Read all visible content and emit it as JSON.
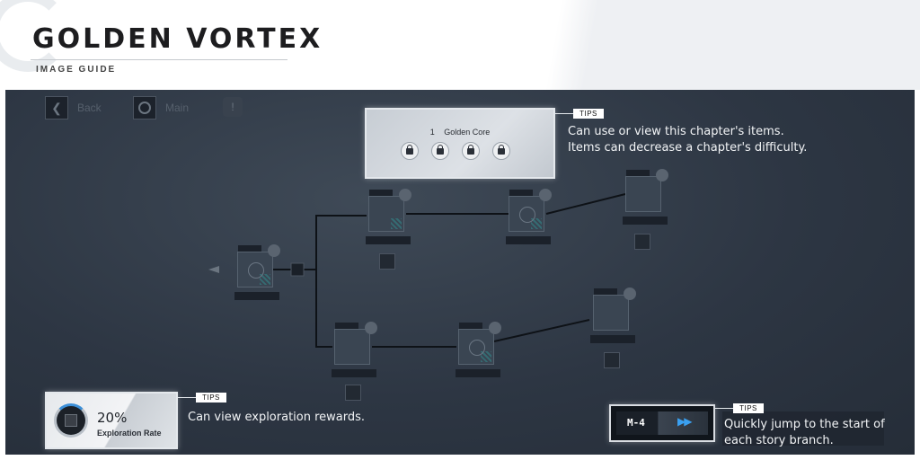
{
  "header": {
    "title": "GOLDEN VORTEX",
    "subtitle": "IMAGE GUIDE"
  },
  "nav": {
    "back_label": "Back",
    "back_icon": "chevron-left-icon",
    "main_label": "Main",
    "main_icon": "circle-icon",
    "info_icon": "info-icon"
  },
  "items_panel": {
    "count": "1",
    "item_name": "Golden Core",
    "slots": [
      "lock-icon",
      "lock-icon",
      "lock-icon",
      "lock-icon"
    ],
    "tips_tag": "TIPS",
    "tips_line1": "Can use or view this chapter's items.",
    "tips_line2": "Items can decrease a chapter's difficulty."
  },
  "exploration": {
    "percent": "20%",
    "label": "Exploration Rate",
    "progress_fraction": 0.2,
    "tips_tag": "TIPS",
    "tips_text": "Can view exploration rewards."
  },
  "branch": {
    "code": "M-4",
    "icon": "fast-forward-icon",
    "tips_tag": "TIPS",
    "tips_line1": "Quickly jump to the start of",
    "tips_line2": "each story branch."
  },
  "colors": {
    "accent_blue": "#3aa0f0",
    "overlay": "#2d3643",
    "highlight_border": "#e4e8ec"
  }
}
